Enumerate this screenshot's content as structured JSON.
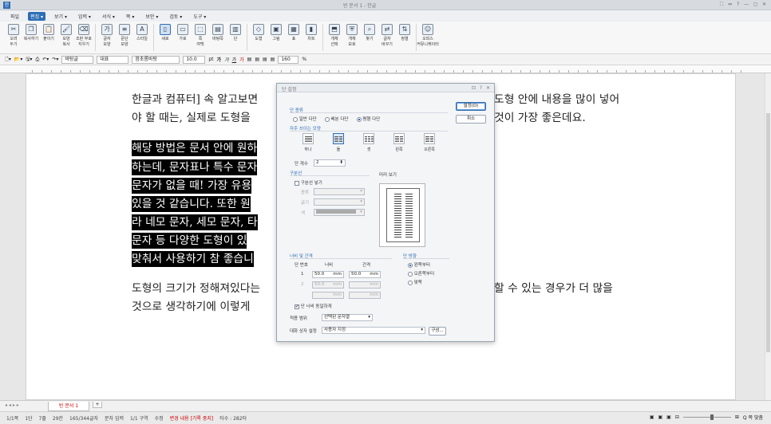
{
  "window": {
    "title": "빈 문서 1 - 한글",
    "controls": "⛶ ⇔ ? — ◻ ✕"
  },
  "menu": [
    {
      "label": "파일"
    },
    {
      "label": "편집 ▾",
      "active": true
    },
    {
      "label": "보기 ▾"
    },
    {
      "label": "입력 ▾"
    },
    {
      "label": "서식 ▾"
    },
    {
      "label": "쪽 ▾"
    },
    {
      "label": "보안 ▾"
    },
    {
      "label": "검토 ▾"
    },
    {
      "label": "도구 ▾"
    }
  ],
  "ribbon": [
    {
      "label": "오려\n두기",
      "icon": "scissors-icon",
      "glyph": "✂"
    },
    {
      "label": "복사하기",
      "icon": "copy-icon",
      "glyph": "❐"
    },
    {
      "label": "붙이기",
      "icon": "paste-icon",
      "glyph": "📋"
    },
    {
      "label": "모양\n복사",
      "icon": "format-painter-icon",
      "glyph": "🖌"
    },
    {
      "label": "조판 부호\n지우기",
      "icon": "clear-markup-icon",
      "glyph": "⌫"
    },
    {
      "sep": true
    },
    {
      "label": "글자\n모양",
      "icon": "char-shape-icon",
      "glyph": "가"
    },
    {
      "label": "문단\n모양",
      "icon": "para-shape-icon",
      "glyph": "≡"
    },
    {
      "label": "스타일",
      "icon": "style-icon",
      "glyph": "A"
    },
    {
      "sep": true
    },
    {
      "label": "세로",
      "icon": "portrait-icon",
      "glyph": "▯",
      "selected": true
    },
    {
      "label": "가로",
      "icon": "landscape-icon",
      "glyph": "▭"
    },
    {
      "label": "쪽\n여백",
      "icon": "margin-icon",
      "glyph": "⬚"
    },
    {
      "label": "바탕쪽",
      "icon": "master-page-icon",
      "glyph": "▤"
    },
    {
      "label": "단",
      "icon": "columns-icon",
      "glyph": "▥"
    },
    {
      "sep": true
    },
    {
      "label": "도형",
      "icon": "shape-icon",
      "glyph": "◇"
    },
    {
      "label": "그림",
      "icon": "picture-icon",
      "glyph": "▣"
    },
    {
      "label": "표",
      "icon": "table-icon",
      "glyph": "▦"
    },
    {
      "label": "차트",
      "icon": "chart-icon",
      "glyph": "▮"
    },
    {
      "sep": true
    },
    {
      "label": "개체\n선택",
      "icon": "object-select-icon",
      "glyph": "⬒"
    },
    {
      "label": "개체\n보호",
      "icon": "object-protect-icon",
      "glyph": "⛨"
    },
    {
      "label": "찾기",
      "icon": "find-icon",
      "glyph": "⌕"
    },
    {
      "label": "글자\n바꾸기",
      "icon": "replace-icon",
      "glyph": "⇄"
    },
    {
      "label": "정렬",
      "icon": "sort-icon",
      "glyph": "⇅"
    },
    {
      "sep": true
    },
    {
      "label": "오피스\n커뮤니케이터",
      "icon": "communicator-icon",
      "glyph": "☺"
    }
  ],
  "format": {
    "style": "바탕글",
    "lang": "대표",
    "font": "함초롬바탕",
    "size": "10.0",
    "unit": "pt",
    "zoom": "160",
    "zoom_unit": "%"
  },
  "doc": {
    "lines": [
      {
        "text": "한글과 컴퓨터] 속 알고보면",
        "hl": false
      },
      {
        "text": "야 할 때는, 실제로 도형을",
        "hl": false
      },
      {
        "text": "해당 방법은 문서 안에 원하",
        "hl": true
      },
      {
        "text": "하는데, 문자표나 특수 문자",
        "hl": true
      },
      {
        "text": "문자가 없을 때! 가장 유용",
        "hl": true
      },
      {
        "text": "있을 것 같습니다. 또한 원",
        "hl": true
      },
      {
        "text": "라 네모 문자, 세모 문자, 타",
        "hl": true
      },
      {
        "text": "문자 등 다양한 도형이 있",
        "hl": true
      },
      {
        "text": "맞춰서 사용하기 참 좋습니",
        "hl": true
      },
      {
        "text": "도형의 크기가 정해져있다는",
        "hl": false
      },
      {
        "text": "것으로 생각하기에 이렇게",
        "hl": false
      }
    ],
    "right_lines": [
      "도형 안에 내용을 많이 넣어",
      "것이 가장 좋은데요.",
      "할 수 있는 경우가 더 많을"
    ]
  },
  "dialog": {
    "title": "단 설정",
    "ctrl": "⊡ ? ✕",
    "type_group": "단 종류",
    "types": [
      {
        "label": "일반 다단",
        "on": false
      },
      {
        "label": "배분 다단",
        "on": false
      },
      {
        "label": "평행 다단",
        "on": true
      }
    ],
    "frequent_group": "자주 쓰이는 모양",
    "shapes": [
      {
        "label": "하나",
        "n": 1
      },
      {
        "label": "둘",
        "n": 2,
        "sel": true
      },
      {
        "label": "셋",
        "n": 3
      },
      {
        "label": "왼쪽",
        "n": 2
      },
      {
        "label": "오른쪽",
        "n": 2
      }
    ],
    "col_count_label": "단 개수",
    "col_count": "2",
    "sep_group": "구분선",
    "sep_check": "구분선 넣기",
    "sep_kind": "종류",
    "sep_width": "굵기",
    "sep_color": "색",
    "preview_label": "미리 보기",
    "width_group": "너비 및 간격",
    "col_head": "단 번호",
    "width_head": "너비",
    "gap_head": "간격",
    "rows": [
      {
        "no": "1",
        "width": "50.0",
        "wu": "mm",
        "gap": "50.0",
        "gu": "mm",
        "enabled": true
      },
      {
        "no": "2",
        "width": "50.0",
        "wu": "mm",
        "gap": "",
        "gu": "mm",
        "enabled": false
      },
      {
        "no": "",
        "width": "",
        "wu": "mm",
        "gap": "",
        "gu": "mm",
        "enabled": false
      }
    ],
    "dir_group": "단 방향",
    "dirs": [
      {
        "label": "왼쪽부터",
        "on": true
      },
      {
        "label": "오른쪽부터",
        "on": false
      },
      {
        "label": "맞쪽",
        "on": false
      }
    ],
    "equal_check": "단 너비 동일하게",
    "apply_label": "적용 범위",
    "apply_value": "선택된 문자열",
    "dlgset_label": "대화 상자 설정",
    "dlgset_value": "사용자 지정",
    "compose_btn": "구성...",
    "ok_btn": "설정(D)",
    "cancel_btn": "취소"
  },
  "tabbar": {
    "doc_tab": "빈 문서 1",
    "add": "+"
  },
  "status": [
    {
      "text": "1/1쪽"
    },
    {
      "text": "1단"
    },
    {
      "text": "7줄"
    },
    {
      "text": "29칸"
    },
    {
      "text": "165/344글자"
    },
    {
      "text": "문자 입력"
    },
    {
      "text": "1/1 구역"
    },
    {
      "text": "수정"
    },
    {
      "text": "변경 내용 [기록 중지]",
      "red": true
    },
    {
      "text": "타수 : 282타"
    }
  ],
  "zoom_status": "Q 쪽 맞춤"
}
